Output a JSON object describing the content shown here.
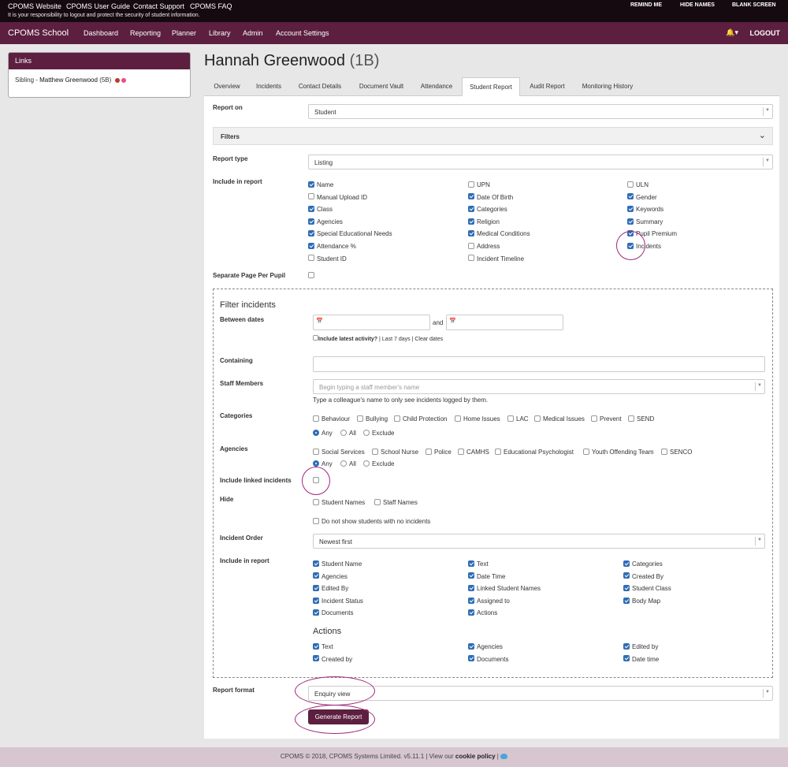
{
  "topbar": {
    "links": [
      "CPOMS Website",
      "CPOMS User Guide",
      "Contact Support",
      "CPOMS FAQ"
    ],
    "notice": "It is your responsibility to logout and protect the security of student information.",
    "right": [
      "REMIND ME",
      "HIDE NAMES",
      "BLANK SCREEN"
    ]
  },
  "nav": {
    "brand": "CPOMS School",
    "items": [
      "Dashboard",
      "Reporting",
      "Planner",
      "Library",
      "Admin",
      "Account Settings"
    ],
    "logout": "LOGOUT"
  },
  "links_panel": {
    "title": "Links",
    "sibling_prefix": "Sibling - ",
    "sibling_name": "Matthew Greenwood",
    "sibling_class": "(5B)"
  },
  "student": {
    "name": "Hannah Greenwood",
    "class": "(1B)"
  },
  "tabs": [
    "Overview",
    "Incidents",
    "Contact Details",
    "Document Vault",
    "Attendance",
    "Student Report",
    "Audit Report",
    "Monitoring History"
  ],
  "active_tab": "Student Report",
  "form": {
    "report_on_label": "Report on",
    "report_on_value": "Student",
    "filters_label": "Filters",
    "report_type_label": "Report type",
    "report_type_value": "Listing",
    "include_label": "Include in report",
    "include_items": [
      {
        "label": "Name",
        "checked": true
      },
      {
        "label": "UPN",
        "checked": false
      },
      {
        "label": "ULN",
        "checked": false
      },
      {
        "label": "Manual Upload ID",
        "checked": false
      },
      {
        "label": "Date Of Birth",
        "checked": true
      },
      {
        "label": "Gender",
        "checked": true
      },
      {
        "label": "Class",
        "checked": true
      },
      {
        "label": "Categories",
        "checked": true
      },
      {
        "label": "Keywords",
        "checked": true
      },
      {
        "label": "Agencies",
        "checked": true
      },
      {
        "label": "Religion",
        "checked": true
      },
      {
        "label": "Summary",
        "checked": true
      },
      {
        "label": "Special Educational Needs",
        "checked": true
      },
      {
        "label": "Medical Conditions",
        "checked": true
      },
      {
        "label": "Pupil Premium",
        "checked": true
      },
      {
        "label": "Attendance %",
        "checked": true
      },
      {
        "label": "Address",
        "checked": false
      },
      {
        "label": "Incidents",
        "checked": true
      },
      {
        "label": "Student ID",
        "checked": false
      },
      {
        "label": "Incident Timeline",
        "checked": false
      }
    ],
    "separate_page_label": "Separate Page Per Pupil",
    "filter_incidents": {
      "title": "Filter incidents",
      "between_dates_label": "Between dates",
      "and": "and",
      "latest_activity": "Include latest activity?",
      "last7": "Last 7 days",
      "clear": "Clear dates",
      "containing_label": "Containing",
      "staff_label": "Staff Members",
      "staff_placeholder": "Begin typing a staff member's name",
      "staff_help": "Type a colleague's name to only see incidents logged by them.",
      "categories_label": "Categories",
      "categories": [
        "Behaviour",
        "Bullying",
        "Child Protection",
        "Home Issues",
        "LAC",
        "Medical Issues",
        "Prevent",
        "SEND"
      ],
      "agencies_label": "Agencies",
      "agencies": [
        "Social Services",
        "School Nurse",
        "Police",
        "CAMHS",
        "Educational Psychologist",
        "Youth Offending Team",
        "SENCO"
      ],
      "match_options": [
        "Any",
        "All",
        "Exclude"
      ],
      "linked_label": "Include linked incidents",
      "hide_label": "Hide",
      "hide_options": [
        "Student Names",
        "Staff Names"
      ],
      "no_incidents": "Do not show students with no incidents",
      "order_label": "Incident Order",
      "order_value": "Newest first",
      "include_label": "Include in report",
      "include_items": [
        {
          "label": "Student Name",
          "checked": true
        },
        {
          "label": "Text",
          "checked": true
        },
        {
          "label": "Categories",
          "checked": true
        },
        {
          "label": "Agencies",
          "checked": true
        },
        {
          "label": "Date Time",
          "checked": true
        },
        {
          "label": "Created By",
          "checked": true
        },
        {
          "label": "Edited By",
          "checked": true
        },
        {
          "label": "Linked Student Names",
          "checked": true
        },
        {
          "label": "Student Class",
          "checked": true
        },
        {
          "label": "Incident Status",
          "checked": true
        },
        {
          "label": "Assigned to",
          "checked": true
        },
        {
          "label": "Body Map",
          "checked": true
        },
        {
          "label": "Documents",
          "checked": true
        },
        {
          "label": "Actions",
          "checked": true
        }
      ],
      "actions_title": "Actions",
      "actions_items": [
        {
          "label": "Text",
          "checked": true
        },
        {
          "label": "Agencies",
          "checked": true
        },
        {
          "label": "Edited by",
          "checked": true
        },
        {
          "label": "Created by",
          "checked": true
        },
        {
          "label": "Documents",
          "checked": true
        },
        {
          "label": "Date time",
          "checked": true
        }
      ]
    },
    "report_format_label": "Report format",
    "report_format_value": "Enquiry view",
    "generate_label": "Generate Report"
  },
  "footer": {
    "text": "CPOMS © 2018, CPOMS Systems Limited. v5.11.1 | View our ",
    "link": "cookie policy",
    "sep": " | "
  },
  "colors": {
    "brand": "#5c1f3f",
    "checkbox": "#2f6db5",
    "highlight": "#a0287a"
  }
}
